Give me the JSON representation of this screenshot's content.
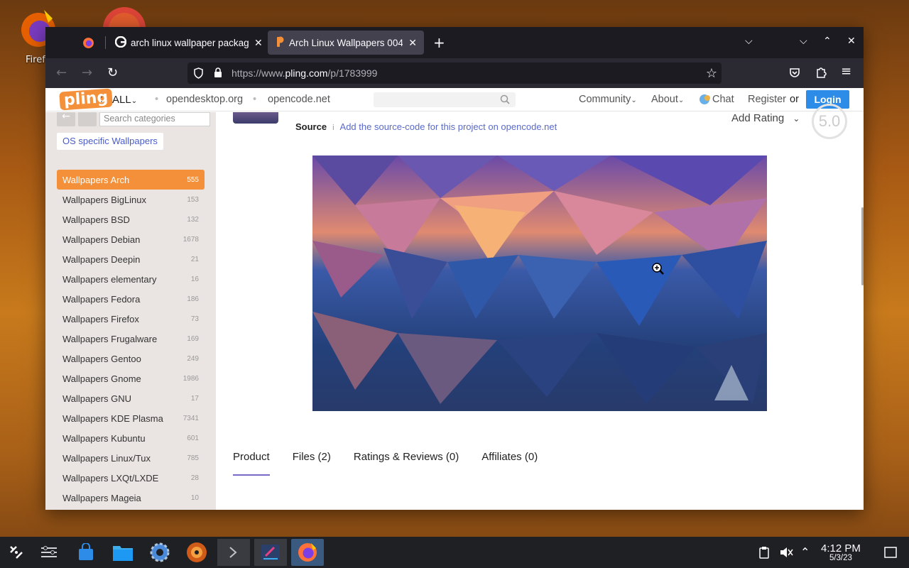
{
  "desktop": {
    "icon_label": "Firefox"
  },
  "browser": {
    "tabs": [
      {
        "title": "arch linux wallpaper package",
        "favicon": "google-g-icon"
      },
      {
        "title": "Arch Linux Wallpapers 004",
        "favicon": "pling-p-icon"
      }
    ],
    "url_prefix": "https://www.",
    "url_domain": "pling.com",
    "url_path": "/p/1783999"
  },
  "site": {
    "logo": "pling",
    "sep": ":",
    "all_label": "ALL",
    "links": [
      "opendesktop.org",
      "opencode.net"
    ],
    "nav": {
      "community": "Community",
      "about": "About",
      "chat": "Chat",
      "register": "Register",
      "or": "or",
      "login": "Login"
    }
  },
  "sidebar": {
    "search_placeholder": "Search categories",
    "os_tag": "OS specific Wallpapers",
    "categories": [
      {
        "label": "Wallpapers Arch",
        "count": "555",
        "active": true
      },
      {
        "label": "Wallpapers BigLinux",
        "count": "153"
      },
      {
        "label": "Wallpapers BSD",
        "count": "132"
      },
      {
        "label": "Wallpapers Debian",
        "count": "1678"
      },
      {
        "label": "Wallpapers Deepin",
        "count": "21"
      },
      {
        "label": "Wallpapers elementary",
        "count": "16"
      },
      {
        "label": "Wallpapers Fedora",
        "count": "186"
      },
      {
        "label": "Wallpapers Firefox",
        "count": "73"
      },
      {
        "label": "Wallpapers Frugalware",
        "count": "169"
      },
      {
        "label": "Wallpapers Gentoo",
        "count": "249"
      },
      {
        "label": "Wallpapers Gnome",
        "count": "1986"
      },
      {
        "label": "Wallpapers GNU",
        "count": "17"
      },
      {
        "label": "Wallpapers KDE Plasma",
        "count": "7341"
      },
      {
        "label": "Wallpapers Kubuntu",
        "count": "601"
      },
      {
        "label": "Wallpapers Linux/Tux",
        "count": "785"
      },
      {
        "label": "Wallpapers LXQt/LXDE",
        "count": "28"
      },
      {
        "label": "Wallpapers Mageia",
        "count": "10"
      }
    ]
  },
  "product": {
    "source_label": "Source",
    "source_info": "i",
    "source_link": "Add the source-code for this project on opencode.net",
    "add_rating": "Add Rating",
    "score": "5.0",
    "tabs": [
      "Product",
      "Files (2)",
      "Ratings & Reviews (0)",
      "Affiliates (0)"
    ]
  },
  "taskbar": {
    "time": "4:12 PM",
    "date": "5/3/23"
  }
}
